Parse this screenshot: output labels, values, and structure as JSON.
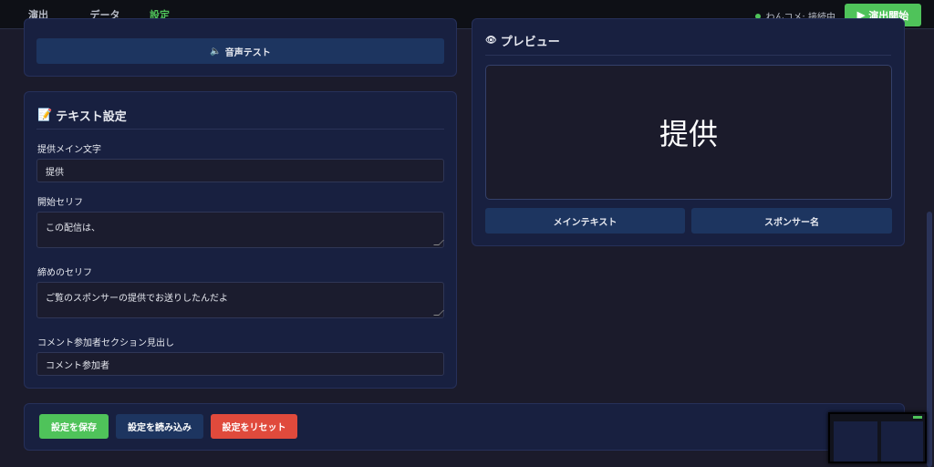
{
  "tabs": [
    {
      "label": "演出"
    },
    {
      "label": "データ"
    },
    {
      "label": "設定"
    }
  ],
  "status": {
    "text": "わんコメ: 接続中",
    "color": "#4fc35a"
  },
  "start_button": {
    "label": "演出開始"
  },
  "audio": {
    "test_label": "音声テスト"
  },
  "text_settings": {
    "title": "テキスト設定",
    "main_label": "提供メイン文字",
    "main_value": "提供",
    "start_label": "開始セリフ",
    "start_value": "この配信は、",
    "end_label": "締めのセリフ",
    "end_value": "ご覧のスポンサーの提供でお送りしたんだよ",
    "section_label": "コメント参加者セクション見出し",
    "section_value": "コメント参加者"
  },
  "preview": {
    "title": "プレビュー",
    "display_text": "提供",
    "buttons": [
      "メインテキスト",
      "スポンサー名"
    ]
  },
  "footer": {
    "save": "設定を保存",
    "load": "設定を読み込み",
    "reset": "設定をリセット"
  }
}
